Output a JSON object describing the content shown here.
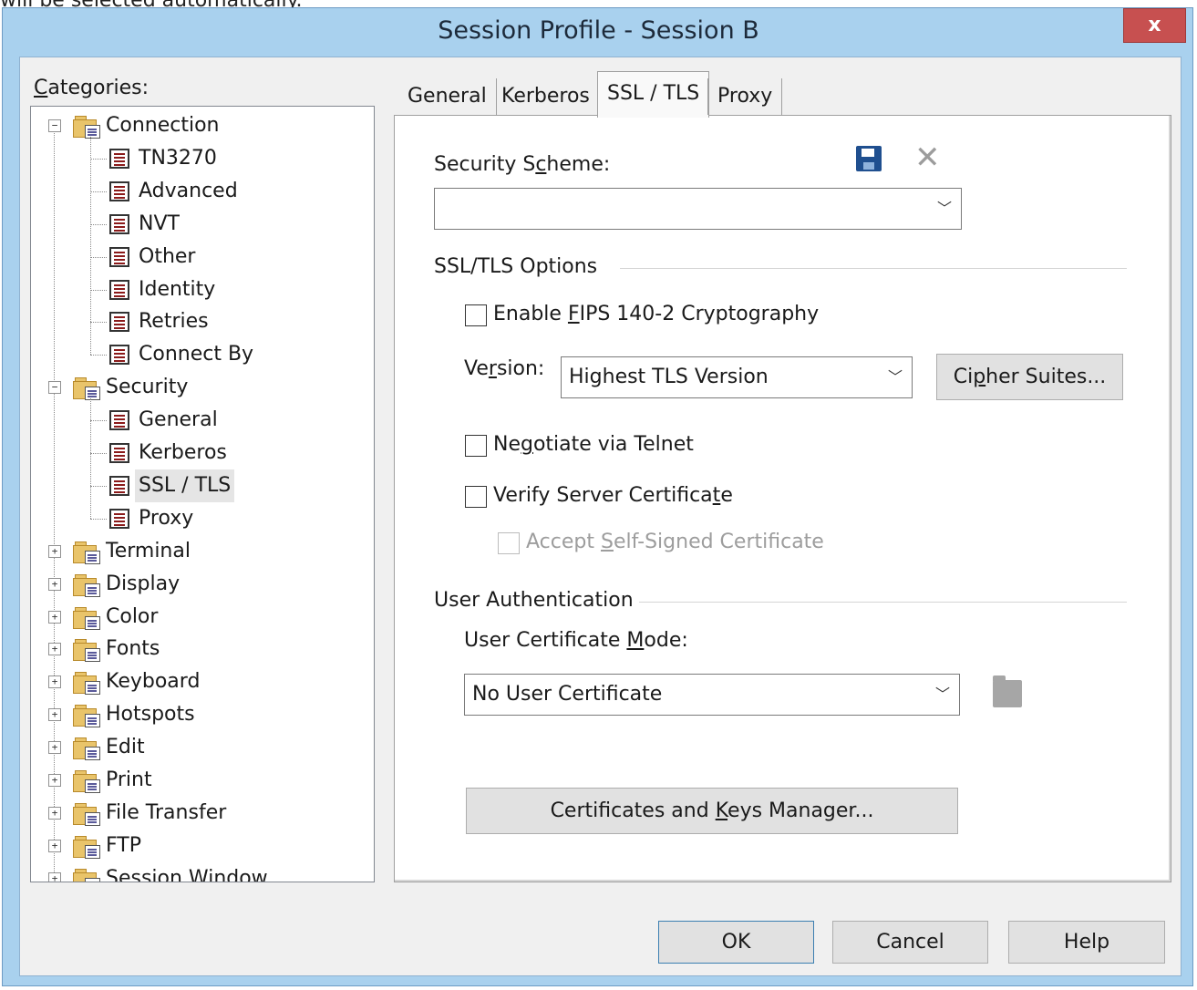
{
  "page_top_text": "will be selected automatically.",
  "window": {
    "title": "Session Profile - Session B",
    "close_label": "x"
  },
  "categories": {
    "label": "Categories:",
    "tree": [
      {
        "label": "Connection",
        "type": "folder",
        "level": 0,
        "expander": "−"
      },
      {
        "label": "TN3270",
        "type": "page",
        "level": 1
      },
      {
        "label": "Advanced",
        "type": "page",
        "level": 1
      },
      {
        "label": "NVT",
        "type": "page",
        "level": 1
      },
      {
        "label": "Other",
        "type": "page",
        "level": 1
      },
      {
        "label": "Identity",
        "type": "page",
        "level": 1
      },
      {
        "label": "Retries",
        "type": "page",
        "level": 1
      },
      {
        "label": "Connect By",
        "type": "page",
        "level": 1
      },
      {
        "label": "Security",
        "type": "folder",
        "level": 0,
        "expander": "−"
      },
      {
        "label": "General",
        "type": "page",
        "level": 1
      },
      {
        "label": "Kerberos",
        "type": "page",
        "level": 1
      },
      {
        "label": "SSL / TLS",
        "type": "page",
        "level": 1,
        "selected": true
      },
      {
        "label": "Proxy",
        "type": "page",
        "level": 1
      },
      {
        "label": "Terminal",
        "type": "folder",
        "level": 0,
        "expander": "+"
      },
      {
        "label": "Display",
        "type": "folder",
        "level": 0,
        "expander": "+"
      },
      {
        "label": "Color",
        "type": "folder",
        "level": 0,
        "expander": "+"
      },
      {
        "label": "Fonts",
        "type": "folder",
        "level": 0,
        "expander": "+"
      },
      {
        "label": "Keyboard",
        "type": "folder",
        "level": 0,
        "expander": "+"
      },
      {
        "label": "Hotspots",
        "type": "folder",
        "level": 0,
        "expander": "+"
      },
      {
        "label": "Edit",
        "type": "folder",
        "level": 0,
        "expander": "+"
      },
      {
        "label": "Print",
        "type": "folder",
        "level": 0,
        "expander": "+"
      },
      {
        "label": "File Transfer",
        "type": "folder",
        "level": 0,
        "expander": "+"
      },
      {
        "label": "FTP",
        "type": "folder",
        "level": 0,
        "expander": "+"
      },
      {
        "label": "Session Window",
        "type": "folder",
        "level": 0,
        "expander": "+"
      }
    ]
  },
  "tabs": [
    {
      "label": "General",
      "active": false
    },
    {
      "label": "Kerberos",
      "active": false
    },
    {
      "label": "SSL / TLS",
      "active": true
    },
    {
      "label": "Proxy",
      "active": false
    }
  ],
  "panel": {
    "security_scheme_label": "Security Scheme:",
    "security_scheme_value": "",
    "ssl_group_label": "SSL/TLS Options",
    "fips_label": "Enable FIPS 140-2 Cryptography",
    "fips_checked": false,
    "version_label": "Version:",
    "version_value": "Highest TLS Version",
    "cipher_button": "Cipher Suites...",
    "negotiate_label": "Negotiate via Telnet",
    "negotiate_checked": false,
    "verify_label": "Verify Server Certificate",
    "verify_checked": false,
    "selfsigned_label": "Accept Self-Signed Certificate",
    "selfsigned_checked": false,
    "selfsigned_enabled": false,
    "user_auth_group_label": "User Authentication",
    "user_cert_mode_label": "User Certificate Mode:",
    "user_cert_mode_value": "No User Certificate",
    "cert_manager_button": "Certificates and Keys Manager..."
  },
  "footer": {
    "ok": "OK",
    "cancel": "Cancel",
    "help": "Help"
  },
  "icons": {
    "save": "save-icon",
    "delete": "delete-icon",
    "browse": "folder-browse-icon",
    "dropdown": "chevron-down-icon"
  },
  "colors": {
    "frame": "#a9d1ee",
    "close_button": "#c75050",
    "dialog_bg": "#f0f0f0"
  }
}
